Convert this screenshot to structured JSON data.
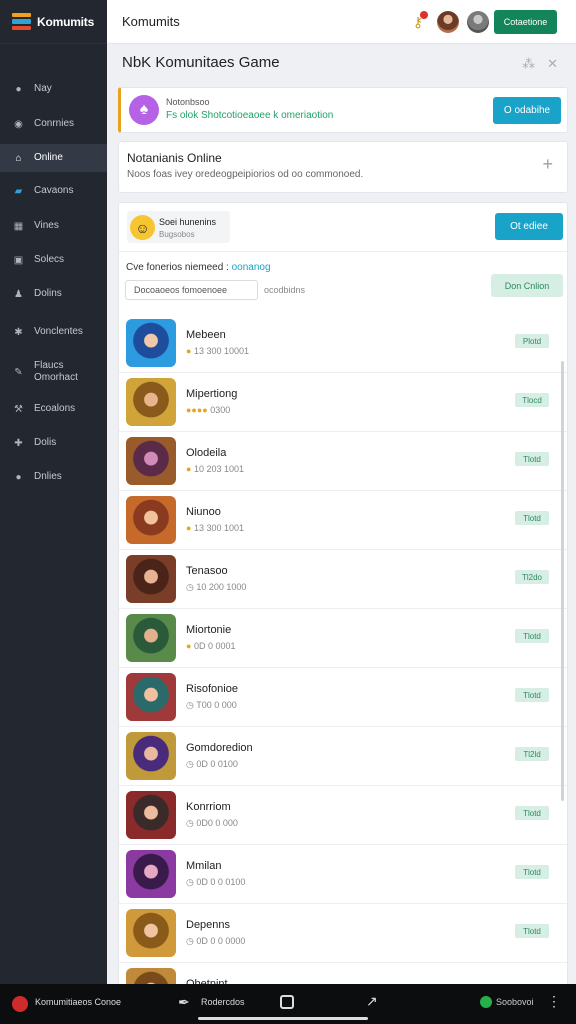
{
  "brand": {
    "name": "Komumits",
    "colors": [
      "#f0a21c",
      "#2fa2d6",
      "#e44a2c"
    ]
  },
  "header": {
    "title": "Komumits",
    "action_label": "Cotaetione",
    "notification_icon": "key-icon",
    "accent": "#14855a"
  },
  "sidebar": {
    "items": [
      {
        "label": "Nay",
        "icon": "dot-icon"
      },
      {
        "label": "Conrnies",
        "icon": "info-icon"
      },
      {
        "label": "Online",
        "icon": "home-icon",
        "active": true
      },
      {
        "label": "Cavaons",
        "icon": "chart-icon"
      },
      {
        "label": "Vines",
        "icon": "grid-icon"
      },
      {
        "label": "Solecs",
        "icon": "square-icon"
      },
      {
        "label": "Dolins",
        "icon": "person-icon"
      },
      {
        "label": "Vonclentes",
        "icon": "gear-icon"
      },
      {
        "label": "Flaucs Omorhact",
        "icon": "edit-icon"
      },
      {
        "label": "Ecoalons",
        "icon": "wrench-icon"
      },
      {
        "label": "Dolis",
        "icon": "puzzle-icon"
      },
      {
        "label": "Dnlies",
        "icon": "circle-icon"
      }
    ]
  },
  "page": {
    "title": "NbK Komunitaes Game"
  },
  "notice": {
    "line1": "Notonbsoo",
    "line2": "Fs olok Shotcotioeaoee k omeriaotion",
    "button": "O odabihe"
  },
  "online": {
    "title": "Notanianis Online",
    "subtitle": "Noos foas ivey oredeogpeipiorios od oo commonoed.",
    "add_icon": "plus-icon"
  },
  "filter_card": {
    "emoji_title": "Soei hunenins",
    "emoji_sub": "Bugsobos",
    "button": "Ot ediee",
    "label_prefix": "Cve fonerios niemeed :",
    "label_highlight": "oonanog",
    "search_value": "Docoaoeos fomoenoee",
    "search_hint": "ocodbidns",
    "mint_button": "Don Cnlion"
  },
  "games": [
    {
      "name": "Mebeen",
      "meta": "13 300 10001",
      "badge": "Plotd"
    },
    {
      "name": "Mipertiong",
      "meta": "0300",
      "badge": "Tlocd"
    },
    {
      "name": "Olodeila",
      "meta": "10 203 1001",
      "badge": "Tlotd"
    },
    {
      "name": "Niunoo",
      "meta": "13 300 1001",
      "badge": "Tlotd"
    },
    {
      "name": "Tenasoo",
      "meta": "10 200 1000",
      "badge": "Tl2do"
    },
    {
      "name": "Miortonie",
      "meta": "0D 0 0001",
      "badge": "Tlotd"
    },
    {
      "name": "Risofonioe",
      "meta": "T00 0 000",
      "badge": "Tlotd"
    },
    {
      "name": "Gomdoredion",
      "meta": "0D 0 0100",
      "badge": "Tl2ld"
    },
    {
      "name": "Konrriom",
      "meta": "0D0 0 000",
      "badge": "Tlotd"
    },
    {
      "name": "Mmilan",
      "meta": "0D 0 0 0100",
      "badge": "Tlotd"
    },
    {
      "name": "Depenns",
      "meta": "0D 0 0 0000",
      "badge": "Tlotd"
    },
    {
      "name": "Obetnint",
      "meta": "",
      "badge": ""
    }
  ],
  "bottombar": {
    "left_text": "Komumitiaeos Conoe",
    "mid_text": "Rodercdos",
    "right_text": "Soobovoi"
  }
}
